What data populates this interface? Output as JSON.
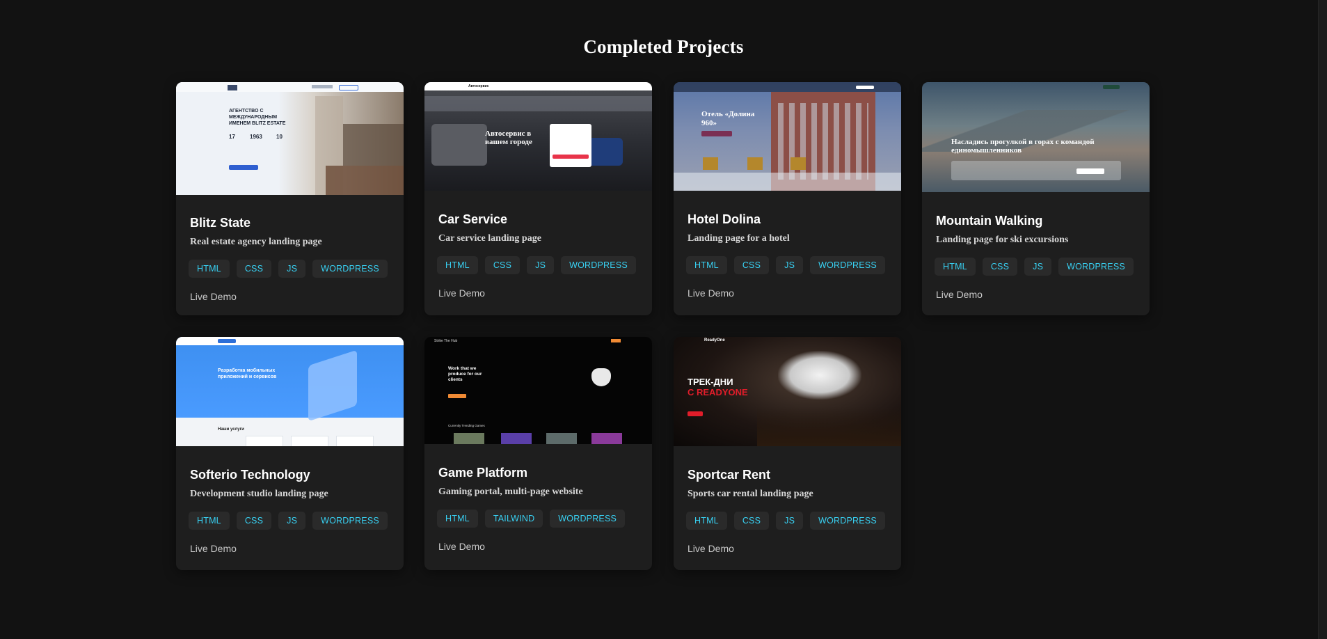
{
  "page": {
    "title": "Completed Projects"
  },
  "projects": [
    {
      "title": "Blitz State",
      "description": "Real estate agency landing page",
      "tags": [
        "HTML",
        "CSS",
        "JS",
        "WORDPRESS"
      ],
      "link": "Live Demo",
      "preview": {
        "heading": "АГЕНТСТВО С МЕЖДУНАРОДНЫМ ИМЕНЕМ BLITZ ESTATE",
        "stats": [
          "17",
          "1963",
          "10"
        ]
      }
    },
    {
      "title": "Car Service",
      "description": "Car service landing page",
      "tags": [
        "HTML",
        "CSS",
        "JS",
        "WORDPRESS"
      ],
      "link": "Live Demo",
      "preview": {
        "heading": "Автосервис в вашем городе",
        "brand": "Автосервис"
      }
    },
    {
      "title": "Hotel Dolina",
      "description": "Landing page for a hotel",
      "tags": [
        "HTML",
        "CSS",
        "JS",
        "WORDPRESS"
      ],
      "link": "Live Demo",
      "preview": {
        "heading": "Отель «Долина 960»"
      }
    },
    {
      "title": "Mountain Walking",
      "description": "Landing page for ski excursions",
      "tags": [
        "HTML",
        "CSS",
        "JS",
        "WORDPRESS"
      ],
      "link": "Live Demo",
      "preview": {
        "heading": "Насладись прогулкой в горах с командой единомышленников"
      }
    },
    {
      "title": "Softerio Technology",
      "description": "Development studio landing page",
      "tags": [
        "HTML",
        "CSS",
        "JS",
        "WORDPRESS"
      ],
      "link": "Live Demo",
      "preview": {
        "heading": "Разработка мобильных приложений и сервисов",
        "sub": "Наши услуги"
      }
    },
    {
      "title": "Game Platform",
      "description": "Gaming portal, multi-page website",
      "tags": [
        "HTML",
        "TAILWIND",
        "WORDPRESS"
      ],
      "link": "Live Demo",
      "preview": {
        "heading": "Work that we produce for our clients",
        "brand": "Strike The Hub",
        "sub": "Currently Trending Games"
      }
    },
    {
      "title": "Sportcar Rent",
      "description": "Sports car rental landing page",
      "tags": [
        "HTML",
        "CSS",
        "JS",
        "WORDPRESS"
      ],
      "link": "Live Demo",
      "preview": {
        "heading1": "ТРЕК-ДНИ",
        "heading2": "С READYONE",
        "brand": "ReadyOne"
      }
    }
  ],
  "colors": {
    "background": "#121212",
    "card": "#1e1e1e",
    "tag_text": "#38d1f3",
    "tag_bg": "#2a2a2a"
  }
}
